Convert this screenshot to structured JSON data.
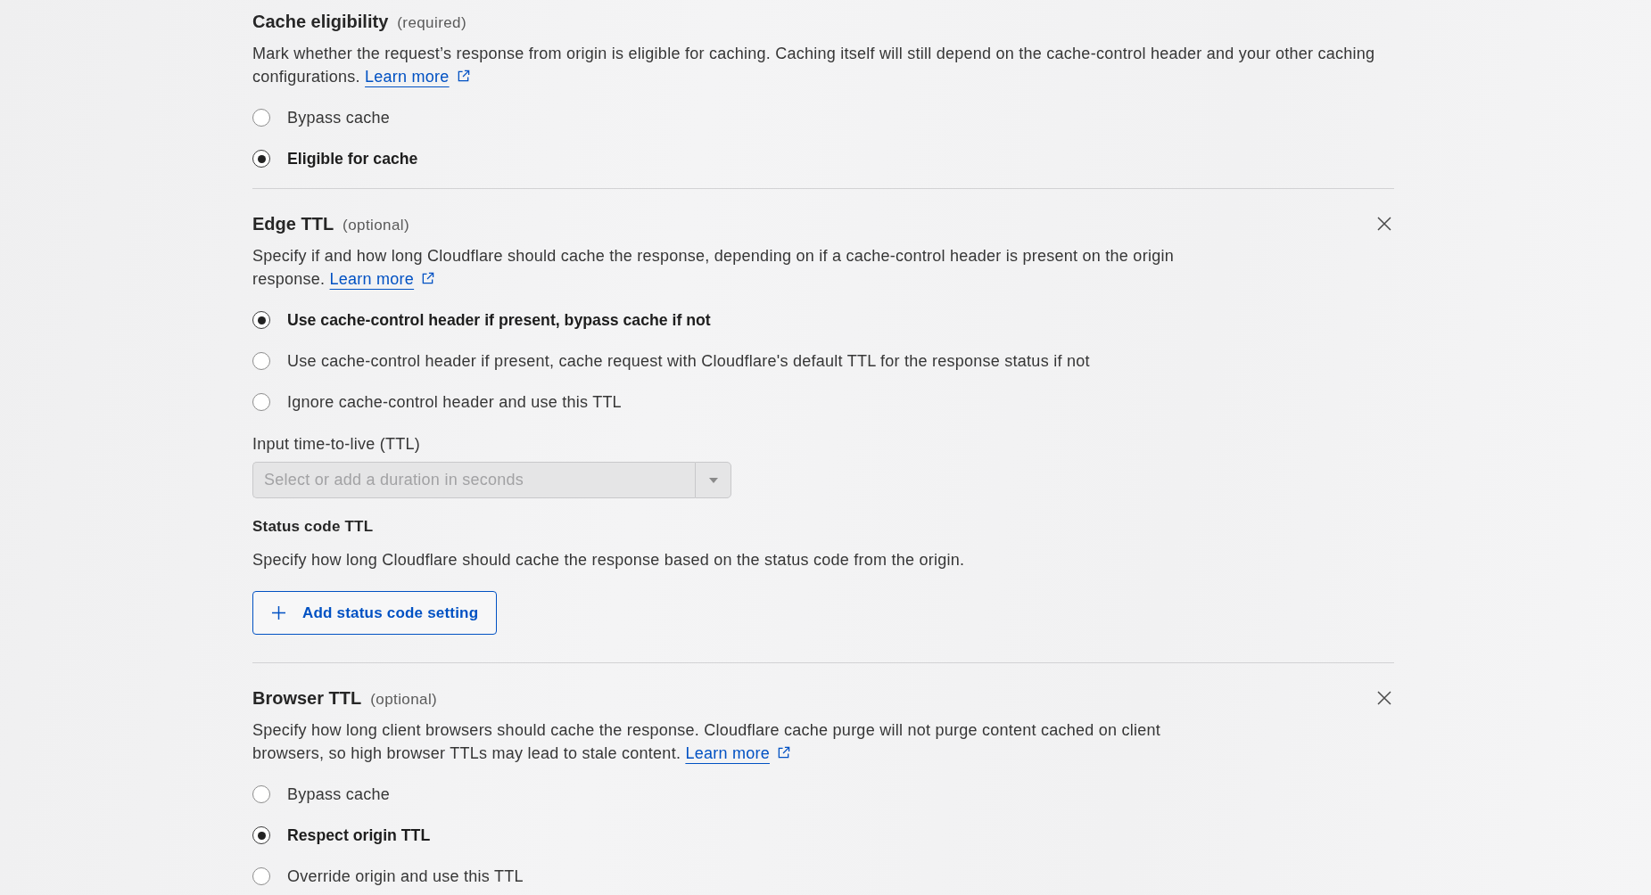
{
  "sections": [
    {
      "title": "Cache eligibility",
      "hint": "(required)",
      "closable": false,
      "description": "Mark whether the request’s response from origin is eligible for caching. Caching itself will still depend on the cache-control header and your other caching configurations.",
      "link": "Learn more",
      "options": [
        {
          "label": "Bypass cache",
          "selected": false
        },
        {
          "label": "Eligible for cache",
          "selected": true
        }
      ]
    },
    {
      "title": "Edge TTL",
      "hint": "(optional)",
      "closable": true,
      "description": "Specify if and how long Cloudflare should cache the response, depending on if a cache-control header is present on the origin response.",
      "link": "Learn more",
      "options": [
        {
          "label": "Use cache-control header if present, bypass cache if not",
          "selected": true
        },
        {
          "label": "Use cache-control header if present, cache request with Cloudflare's default TTL for the response status if not",
          "selected": false
        },
        {
          "label": "Ignore cache-control header and use this TTL",
          "selected": false
        }
      ],
      "ttl_field": {
        "label": "Input time-to-live (TTL)",
        "placeholder": "Select or add a duration in seconds",
        "disabled": true
      },
      "status_code_ttl": {
        "title": "Status code TTL",
        "description": "Specify how long Cloudflare should cache the response based on the status code from the origin.",
        "button": "Add status code setting"
      }
    },
    {
      "title": "Browser TTL",
      "hint": "(optional)",
      "closable": true,
      "description": "Specify how long client browsers should cache the response. Cloudflare cache purge will not purge content cached on client browsers, so high browser TTLs may lead to stale content.",
      "link": "Learn more",
      "options": [
        {
          "label": "Bypass cache",
          "selected": false
        },
        {
          "label": "Respect origin TTL",
          "selected": true
        },
        {
          "label": "Override origin and use this TTL",
          "selected": false
        }
      ]
    }
  ]
}
